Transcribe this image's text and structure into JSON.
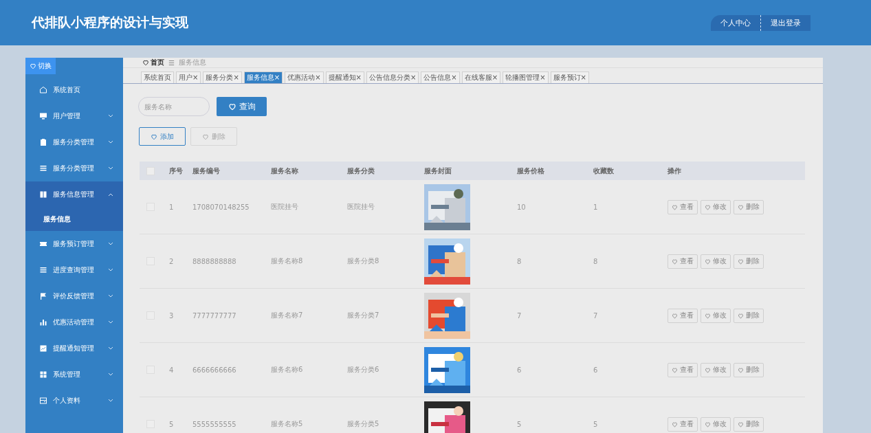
{
  "header": {
    "title": "代排队小程序的设计与实现",
    "links": [
      "个人中心",
      "退出登录"
    ]
  },
  "sidebar": {
    "toggle": "切换",
    "items": [
      {
        "label": "系统首页",
        "expanded": false
      },
      {
        "label": "用户管理",
        "expanded": false
      },
      {
        "label": "服务分类管理",
        "expanded": false
      },
      {
        "label": "服务分类管理",
        "expanded": false
      },
      {
        "label": "服务信息管理",
        "expanded": true,
        "children": [
          {
            "label": "服务信息",
            "selected": true
          }
        ]
      },
      {
        "label": "服务预订管理",
        "expanded": false
      },
      {
        "label": "进度查询管理",
        "expanded": false
      },
      {
        "label": "评价反馈管理",
        "expanded": false
      },
      {
        "label": "优惠活动管理",
        "expanded": false
      },
      {
        "label": "提醒通知管理",
        "expanded": false
      },
      {
        "label": "系统管理",
        "expanded": false
      },
      {
        "label": "个人资料",
        "expanded": false
      }
    ]
  },
  "breadcrumb": {
    "home": "首页",
    "separator": "☰",
    "current": "服务信息"
  },
  "tabs": [
    {
      "label": "系统首页",
      "selected": false
    },
    {
      "label": "用户",
      "close": "×",
      "selected": false
    },
    {
      "label": "服务分类",
      "close": "×",
      "selected": false
    },
    {
      "label": "服务信息",
      "close": "×",
      "selected": true
    },
    {
      "label": "优惠活动",
      "close": "×",
      "selected": false
    },
    {
      "label": "提醒通知",
      "close": "×",
      "selected": false
    },
    {
      "label": "公告信息分类",
      "close": "×",
      "selected": false
    },
    {
      "label": "公告信息",
      "close": "×",
      "selected": false
    },
    {
      "label": "在线客服",
      "close": "×",
      "selected": false
    },
    {
      "label": "轮播图管理",
      "close": "×",
      "selected": false
    },
    {
      "label": "服务预订",
      "close": "×",
      "selected": false
    }
  ],
  "search": {
    "placeholder": "服务名称",
    "button": "查询"
  },
  "actions": [
    "添加",
    "删除"
  ],
  "table": {
    "all_checked": false,
    "columns": [
      "序号",
      "服务编号",
      "服务名称",
      "服务分类",
      "服务封面",
      "服务价格",
      "收藏数",
      "操作"
    ],
    "rows": [
      {
        "checked": false,
        "index": "1",
        "code": "1708070148255",
        "name": "医院挂号",
        "category": "医院挂号",
        "price": "10",
        "favorites": "1",
        "actions": [
          "查看",
          "修改",
          "删除"
        ]
      },
      {
        "checked": false,
        "index": "2",
        "code": "8888888888",
        "name": "服务名称8",
        "category": "服务分类8",
        "price": "8",
        "favorites": "8",
        "actions": [
          "查看",
          "修改",
          "删除"
        ]
      },
      {
        "checked": false,
        "index": "3",
        "code": "7777777777",
        "name": "服务名称7",
        "category": "服务分类7",
        "price": "7",
        "favorites": "7",
        "actions": [
          "查看",
          "修改",
          "删除"
        ]
      },
      {
        "checked": false,
        "index": "4",
        "code": "6666666666",
        "name": "服务名称6",
        "category": "服务分类6",
        "price": "6",
        "favorites": "6",
        "actions": [
          "查看",
          "修改",
          "删除"
        ]
      },
      {
        "checked": false,
        "index": "5",
        "code": "5555555555",
        "name": "服务名称5",
        "category": "服务分类5",
        "price": "5",
        "favorites": "5",
        "actions": [
          "查看",
          "修改",
          "删除"
        ]
      }
    ]
  }
}
